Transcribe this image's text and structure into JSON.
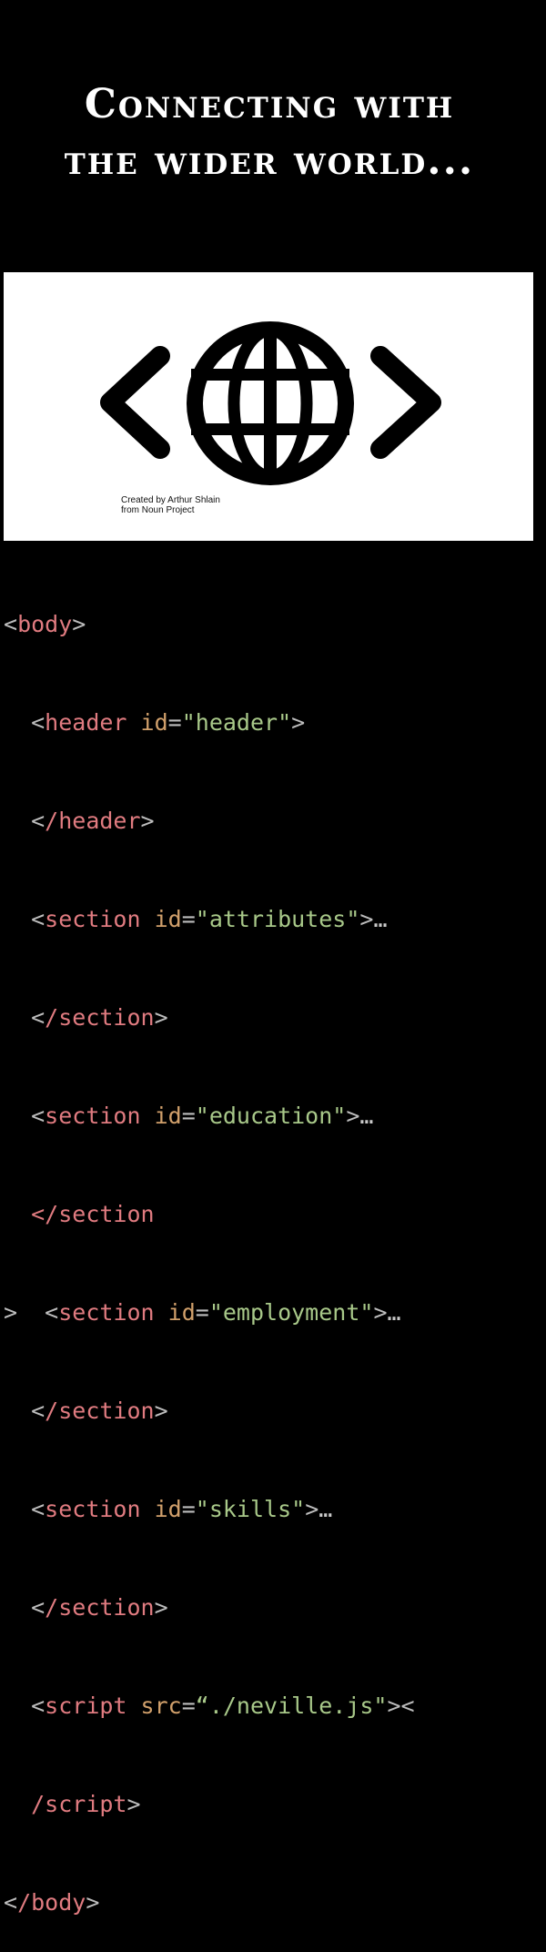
{
  "title": {
    "line1": "Connecting with",
    "line2": "the wider world..."
  },
  "banner": {
    "icon": "code-globe-icon",
    "credit_line1": "Created by Arthur Shlain",
    "credit_line2": "from Noun Project"
  },
  "code": {
    "colors": {
      "tag": "#e07b80",
      "attr": "#d1a06b",
      "value": "#a8c889",
      "punct": "#bdbdbd"
    },
    "body_open": "body",
    "header_tag": "header",
    "header_attr": "id",
    "header_val": "\"header\"",
    "header_close": "/header",
    "section_tag": "section",
    "section_close": "/section",
    "section_close_unterminated": "</section",
    "attributes_val": "\"attributes\"",
    "education_val": "\"education\"",
    "employment_val": "\"employment\"",
    "skills_val": "\"skills\"",
    "collapse_marker": ">",
    "ellipsis": "…",
    "script_tag": "script",
    "script_attr": "src",
    "script_val": "“./neville.js\"",
    "script_close": "/script",
    "body_close": "/body"
  }
}
